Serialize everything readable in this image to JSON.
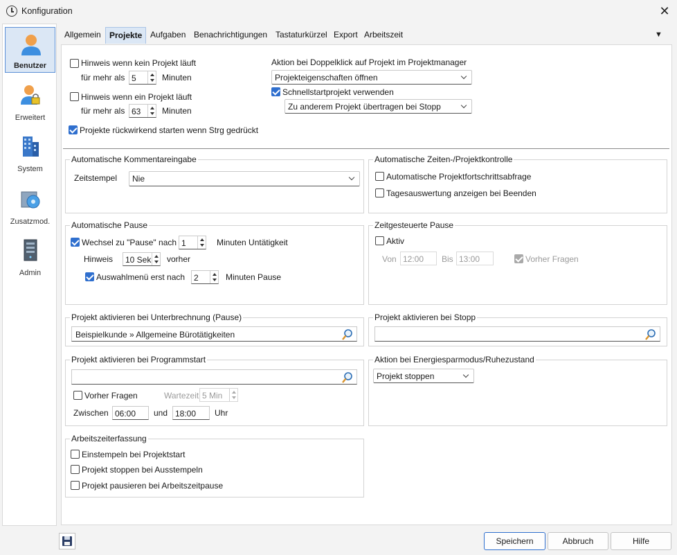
{
  "window": {
    "title": "Konfiguration"
  },
  "sidebar": {
    "items": [
      {
        "label": "Benutzer",
        "icon": "user-icon",
        "active": true
      },
      {
        "label": "Erweitert",
        "icon": "user-lock-icon"
      },
      {
        "label": "System",
        "icon": "building-icon"
      },
      {
        "label": "Zusatzmod.",
        "icon": "module-icon"
      },
      {
        "label": "Admin",
        "icon": "server-icon"
      }
    ]
  },
  "tabs": [
    "Allgemein",
    "Projekte",
    "Aufgaben",
    "Benachrichtigungen",
    "Tastaturkürzel",
    "Export",
    "Arbeitszeit"
  ],
  "active_tab": "Projekte",
  "top": {
    "no_project_hint": "Hinweis wenn kein Projekt läuft",
    "for_more_than": "für mehr als",
    "minutes": "Minuten",
    "no_project_minutes": "5",
    "project_running_hint": "Hinweis wenn ein Projekt läuft",
    "project_running_minutes": "63",
    "retro_start": "Projekte rückwirkend starten wenn Strg gedrückt",
    "dblclick_title": "Aktion bei Doppelklick auf Projekt im Projektmanager",
    "dblclick_value": "Projekteigenschaften öffnen",
    "quickstart_label": "Schnellstartprojekt verwenden",
    "quickstart_value": "Zu anderem Projekt übertragen bei Stopp"
  },
  "comment": {
    "title": "Automatische Kommentareingabe",
    "timestamp_label": "Zeitstempel",
    "timestamp_value": "Nie"
  },
  "control": {
    "title": "Automatische Zeiten-/Projektkontrolle",
    "progress_query": "Automatische Projektfortschrittsabfrage",
    "daily_eval": "Tagesauswertung anzeigen bei Beenden"
  },
  "pause": {
    "title": "Automatische Pause",
    "switch_label": "Wechsel zu \"Pause\" nach",
    "switch_minutes": "1",
    "inactivity": "Minuten Untätigkeit",
    "hint_label": "Hinweis",
    "hint_value": "10 Sek",
    "before": "vorher",
    "menu_label": "Auswahlmenü erst nach",
    "menu_minutes": "2",
    "minutes_pause": "Minuten Pause"
  },
  "timed_pause": {
    "title": "Zeitgesteuerte Pause",
    "active": "Aktiv",
    "from_label": "Von",
    "from_value": "12:00",
    "to_label": "Bis",
    "to_value": "13:00",
    "ask_before": "Vorher Fragen"
  },
  "interrupt": {
    "title": "Projekt aktivieren bei Unterbrechnung (Pause)",
    "value": "Beispielkunde » Allgemeine Bürotätigkeiten"
  },
  "stop": {
    "title": "Projekt aktivieren bei Stopp",
    "value": ""
  },
  "program_start": {
    "title": "Projekt aktivieren bei Programmstart",
    "value": "",
    "ask_before": "Vorher Fragen",
    "wait_label": "Wartezeit",
    "wait_value": "5 Min",
    "between": "Zwischen",
    "from": "06:00",
    "and": "und",
    "to": "18:00",
    "clock": "Uhr"
  },
  "energy": {
    "title": "Aktion bei Energiesparmodus/Ruhezustand",
    "value": "Projekt stoppen"
  },
  "worktime": {
    "title": "Arbeitszeiterfassung",
    "clock_in": "Einstempeln bei Projektstart",
    "stop_on_clock_out": "Projekt stoppen bei Ausstempeln",
    "pause_on_break": "Projekt pausieren bei Arbeitszeitpause"
  },
  "buttons": {
    "save": "Speichern",
    "cancel": "Abbruch",
    "help": "Hilfe"
  },
  "colors": {
    "accent": "#2f6fce",
    "active_bg": "#dbe7f5"
  }
}
